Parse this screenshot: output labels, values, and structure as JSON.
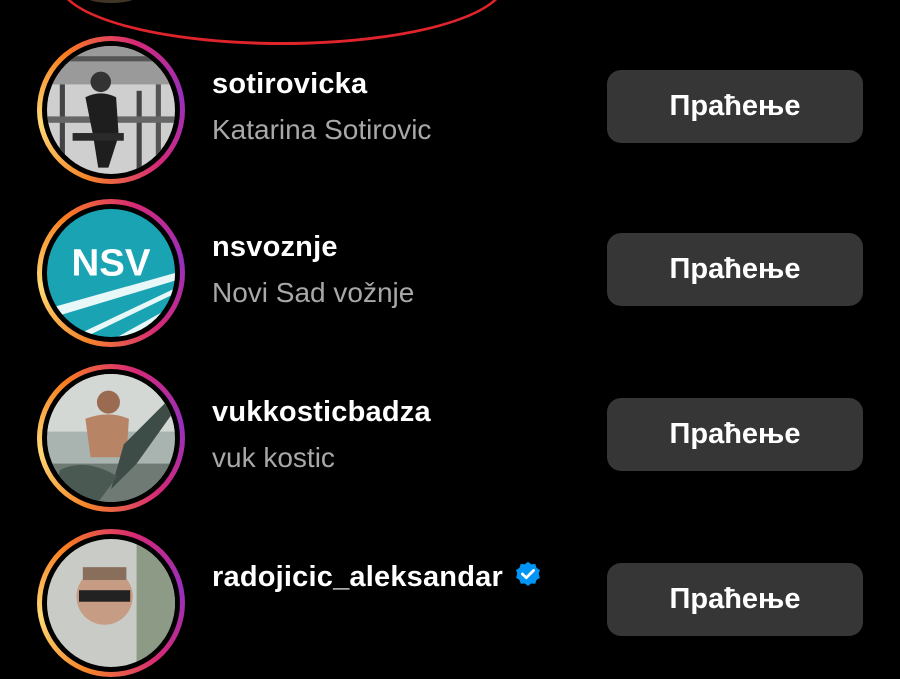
{
  "accounts": [
    {
      "username": "sotirovicka",
      "full_name": "Katarina Sotirovic",
      "follow_label": "Праћење",
      "verified": false,
      "avatar_icon": "profile-photo"
    },
    {
      "username": "nsvoznje",
      "full_name": "Novi Sad vožnje",
      "follow_label": "Праћење",
      "verified": false,
      "avatar_icon": "nsv-logo",
      "avatar_logo_text": "NSV"
    },
    {
      "username": "vukkosticbadza",
      "full_name": "vuk kostic",
      "follow_label": "Праћење",
      "verified": false,
      "avatar_icon": "profile-photo"
    },
    {
      "username": "radojicic_aleksandar",
      "full_name": "",
      "follow_label": "Праћење",
      "verified": true,
      "avatar_icon": "profile-photo"
    }
  ],
  "colors": {
    "background": "#000000",
    "button": "#363636",
    "secondary_text": "#a8a8a8",
    "verified_badge": "#0095f6",
    "annotation_oval": "#e0242b"
  }
}
